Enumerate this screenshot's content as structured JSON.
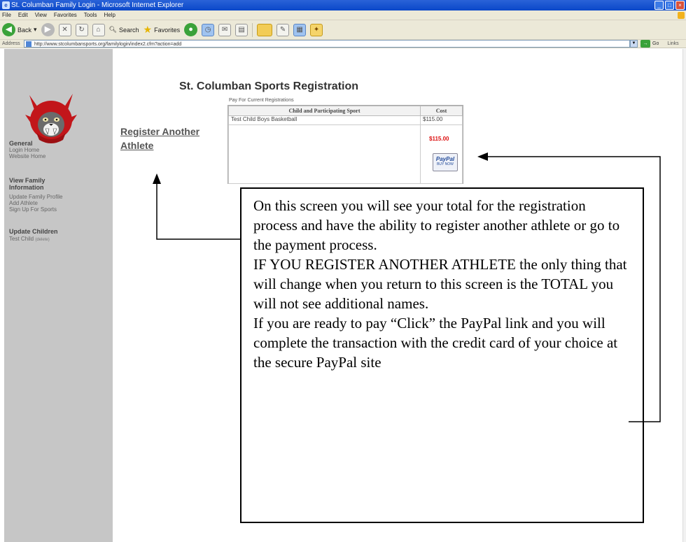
{
  "window": {
    "title": "St. Columban Family Login - Microsoft Internet Explorer",
    "icon": "ie-icon",
    "controls": [
      "_",
      "□",
      "×"
    ]
  },
  "menu": [
    "File",
    "Edit",
    "View",
    "Favorites",
    "Tools",
    "Help"
  ],
  "toolbar": {
    "back_label": "Back",
    "search_label": "Search",
    "favorites_label": "Favorites"
  },
  "address": {
    "label": "Address",
    "url": "http://www.stcolumbansports.org/familylogin/index2.cfm?action=add",
    "go_label": "Go",
    "links_label": "Links"
  },
  "sidebar": {
    "general_heading": "General",
    "general_links": [
      "Login Home",
      "Website Home"
    ],
    "family_heading": "View Family Information",
    "family_links": [
      "Update Family Profile",
      "Add Athlete",
      "Sign Up For Sports"
    ],
    "children_heading": "Update Children",
    "child_name": "Test Child",
    "child_link": "(delete)"
  },
  "main": {
    "title": "St. Columban Sports Registration",
    "register_link": "Register Another Athlete",
    "pay_caption": "Pay For Current Registrations",
    "table_headers": [
      "Child and Participating Sport",
      "Cost"
    ],
    "rows": [
      {
        "name": "Test Child Boys Basketball",
        "cost": "$115.00"
      }
    ],
    "total": "$115.00",
    "paypal_label": "PayPal",
    "paypal_sub": "BUY NOW"
  },
  "annotation": {
    "paragraphs": [
      "On this screen you will see your total for the registration process and have the ability to register another athlete or go to the payment process.",
      "IF YOU REGISTER ANOTHER ATHLETE the only thing that will change when you return to this screen is the TOTAL  you will not see additional names.",
      "If you are ready to pay “Click” the PayPal link and you will complete the transaction with the credit card of your choice at the secure PayPal site"
    ]
  },
  "colors": {
    "sidebar_bg": "#c6c6c6",
    "total_red": "#dd1111",
    "title_bar_blue": "#0a47c9"
  }
}
